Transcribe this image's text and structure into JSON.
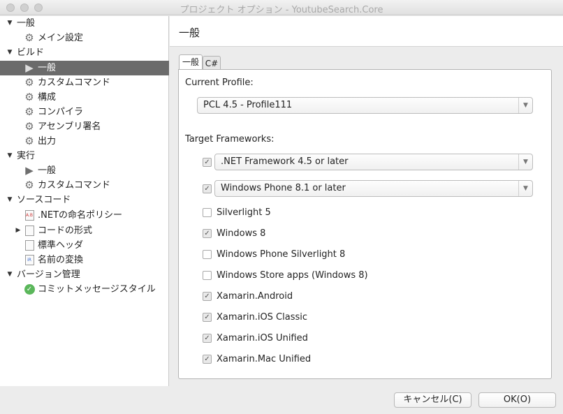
{
  "window": {
    "title": "プロジェクト オプション - YoutubeSearch.Core"
  },
  "sidebar": {
    "items": [
      {
        "label": "一般",
        "expanded": true
      },
      {
        "label": "メイン設定",
        "icon": "gear-icon"
      },
      {
        "label": "ビルド",
        "expanded": true
      },
      {
        "label": "一般",
        "icon": "play-icon",
        "selected": true
      },
      {
        "label": "カスタムコマンド",
        "icon": "gear-icon"
      },
      {
        "label": "構成",
        "icon": "gear-icon"
      },
      {
        "label": "コンパイラ",
        "icon": "gear-icon"
      },
      {
        "label": "アセンブリ署名",
        "icon": "gear-icon"
      },
      {
        "label": "出力",
        "icon": "gear-icon"
      },
      {
        "label": "実行",
        "expanded": true
      },
      {
        "label": "一般",
        "icon": "play-icon"
      },
      {
        "label": "カスタムコマンド",
        "icon": "gear-icon"
      },
      {
        "label": "ソースコード",
        "expanded": true
      },
      {
        "label": ".NETの命名ポリシー",
        "icon": "naming-icon",
        "icon_text": "A.B"
      },
      {
        "label": "コードの形式",
        "icon": "document-icon",
        "expanded": false
      },
      {
        "label": "標準ヘッダ",
        "icon": "document-icon"
      },
      {
        "label": "名前の変換",
        "icon": "rename-icon",
        "icon_text": "iR"
      },
      {
        "label": "バージョン管理",
        "expanded": true
      },
      {
        "label": "コミットメッセージスタイル",
        "icon": "check-circle-icon"
      }
    ]
  },
  "main": {
    "title": "一般",
    "tabs": [
      {
        "label": "一般",
        "active": true
      },
      {
        "label": "C#",
        "active": false
      }
    ],
    "current_profile_label": "Current Profile:",
    "current_profile_value": "PCL 4.5 - Profile111",
    "target_frameworks_label": "Target Frameworks:",
    "framework_combos": [
      {
        "value": ".NET Framework 4.5 or later",
        "checked": true
      },
      {
        "value": "Windows Phone 8.1 or later",
        "checked": true
      }
    ],
    "frameworks": [
      {
        "label": "Silverlight 5",
        "checked": false
      },
      {
        "label": "Windows 8",
        "checked": true
      },
      {
        "label": "Windows Phone Silverlight 8",
        "checked": false
      },
      {
        "label": "Windows Store apps (Windows 8)",
        "checked": false
      },
      {
        "label": "Xamarin.Android",
        "checked": true
      },
      {
        "label": "Xamarin.iOS Classic",
        "checked": true
      },
      {
        "label": "Xamarin.iOS Unified",
        "checked": true
      },
      {
        "label": "Xamarin.Mac Unified",
        "checked": true
      }
    ]
  },
  "footer": {
    "cancel_label": "キャンセル(C)",
    "ok_label": "OK(O)"
  },
  "glyphs": {
    "check": "✓",
    "dropdown": "▼",
    "expanded": "▼",
    "collapsed": "▶",
    "gear": "⚙",
    "play": "▶"
  }
}
